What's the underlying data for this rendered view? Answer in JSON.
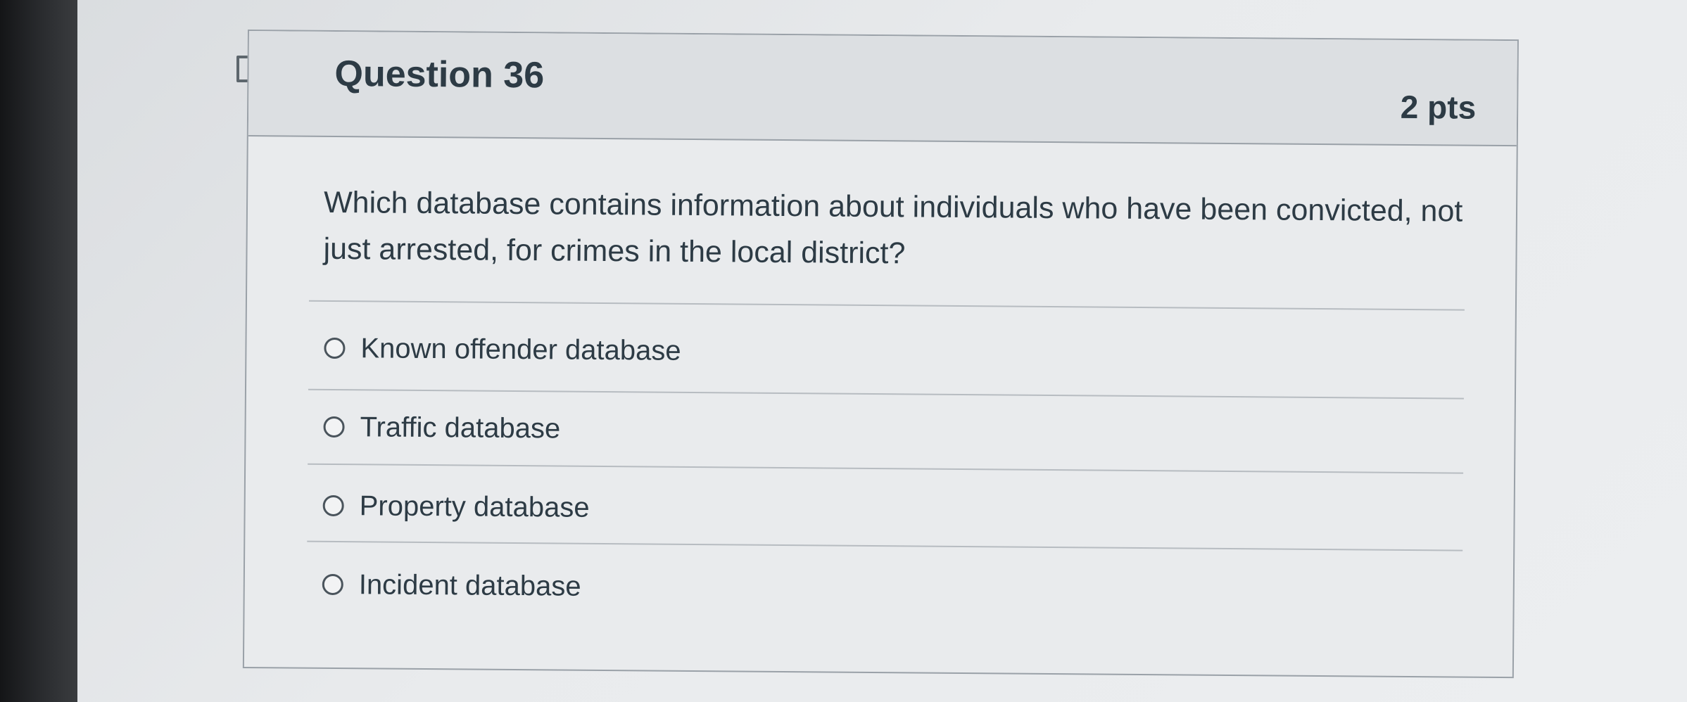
{
  "question": {
    "title": "Question 36",
    "points": "2 pts",
    "text": "Which database contains information about individuals who have been convicted, not just arrested, for crimes in the local district?",
    "flag_icon": "flag-outline-icon"
  },
  "answers": [
    {
      "label": "Known offender database",
      "selected": false
    },
    {
      "label": "Traffic database",
      "selected": false
    },
    {
      "label": "Property database",
      "selected": false
    },
    {
      "label": "Incident database",
      "selected": false
    }
  ],
  "colors": {
    "text": "#2d3b45",
    "header_background": "#dcdfe2",
    "border": "#9aa1a8"
  }
}
